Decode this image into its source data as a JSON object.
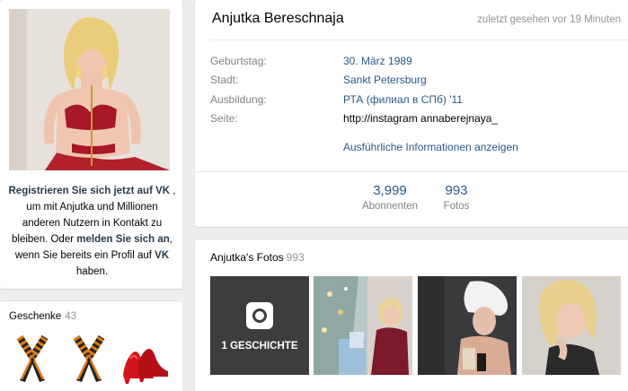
{
  "profile": {
    "name": "Anjutka Bereschnaja",
    "last_seen": "zuletzt gesehen vor 19 Minuten",
    "info": [
      {
        "label": "Geburtstag:",
        "value": "30. März 1989"
      },
      {
        "label": "Stadt:",
        "value": "Sankt Petersburg"
      },
      {
        "label": "Ausbildung:",
        "value": "РТА (филиал в СПб) '11"
      },
      {
        "label": "Seite:",
        "value": "http://instagram annaberejnaya_"
      }
    ],
    "more_link": "Ausführliche Informationen anzeigen",
    "counters": [
      {
        "value": "3,999",
        "label": "Abonnenten"
      },
      {
        "value": "993",
        "label": "Fotos"
      }
    ]
  },
  "promo": {
    "register": "Registrieren Sie sich jetzt auf VK",
    "part1": ", um mit Anjutka und Millionen anderen Nutzern in Kontakt zu bleiben. Oder",
    "login": "melden Sie sich an",
    "part2": ", wenn Sie bereits ein Profil auf",
    "vk": "VK",
    "part3": "haben."
  },
  "gifts": {
    "title": "Geschenke",
    "count": "43",
    "items": [
      "ribbon-icon",
      "ribbon-icon",
      "heels-icon"
    ]
  },
  "photos": {
    "title": "Anjutka's Fotos",
    "count": "993",
    "story_label": "1 GESCHICHTE"
  },
  "colors": {
    "link": "#2a5885",
    "muted": "#828282",
    "background": "#edeef0"
  }
}
